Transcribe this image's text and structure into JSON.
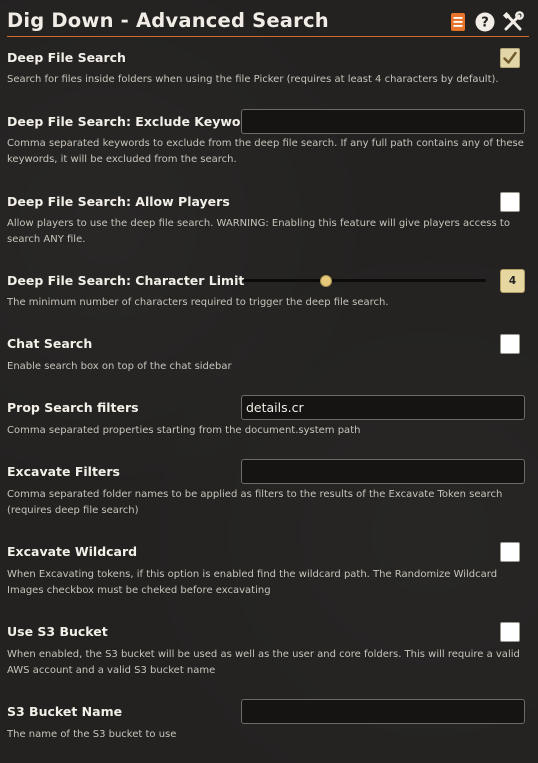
{
  "header": {
    "title": "Dig Down - Advanced Search",
    "icons": [
      "book-icon",
      "help-icon",
      "tools-icon"
    ],
    "accent_color": "#d26a2a"
  },
  "settings": [
    {
      "label": "Deep File Search",
      "hint": "Search for files inside folders when using the file Picker (requires at least 4 characters by default).",
      "control": "checkbox",
      "checked": true
    },
    {
      "label": "Deep File Search: Exclude Keywords",
      "hint": "Comma separated keywords to exclude from the deep file search. If any full path contains any of these keywords, it will be excluded from the search.",
      "control": "text",
      "value": ""
    },
    {
      "label": "Deep File Search: Allow Players",
      "hint": "Allow players to use the deep file search. WARNING: Enabling this feature will give players access to search ANY file.",
      "control": "checkbox",
      "checked": false
    },
    {
      "label": "Deep File Search: Character Limit",
      "hint": "The minimum number of characters required to trigger the deep file search.",
      "control": "range",
      "value": "4",
      "slider_fraction": 0.34
    },
    {
      "label": "Chat Search",
      "hint": "Enable search box on top of the chat sidebar",
      "control": "checkbox",
      "checked": false
    },
    {
      "label": "Prop Search filters",
      "hint": "Comma separated properties starting from the document.system path",
      "control": "text",
      "value": "details.cr"
    },
    {
      "label": "Excavate Filters",
      "hint": "Comma separated folder names to be applied as filters to the results of the Excavate Token search (requires deep file search)",
      "control": "text",
      "value": ""
    },
    {
      "label": "Excavate Wildcard",
      "hint": "When Excavating tokens, if this option is enabled find the wildcard path. The Randomize Wildcard Images checkbox must be cheked before excavating",
      "control": "checkbox",
      "checked": false
    },
    {
      "label": "Use S3 Bucket",
      "hint": "When enabled, the S3 bucket will be used as well as the user and core folders. This will require a valid AWS account and a valid S3 bucket name",
      "control": "checkbox",
      "checked": false
    },
    {
      "label": "S3 Bucket Name",
      "hint": "The name of the S3 bucket to use",
      "control": "text",
      "value": ""
    }
  ]
}
